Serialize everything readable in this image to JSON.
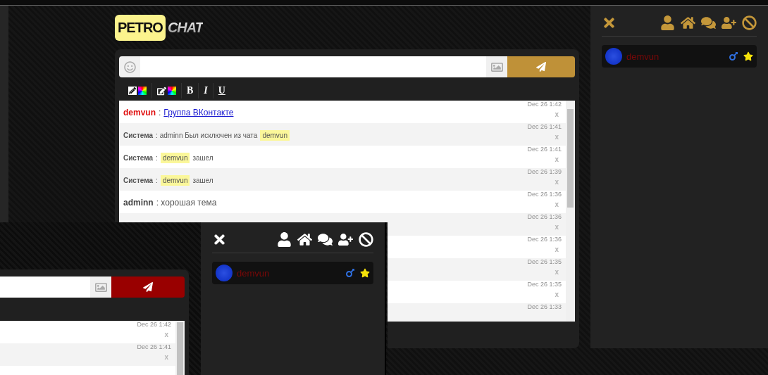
{
  "logo": {
    "part_1": "PETRO",
    "part_2": "CHAT"
  },
  "toolbar": [
    {
      "kind": "pen-color"
    },
    {
      "kind": "edit-color"
    },
    {
      "kind": "bold",
      "label": "B"
    },
    {
      "kind": "italic",
      "label": "I"
    },
    {
      "kind": "underline",
      "label": "U"
    }
  ],
  "messages": [
    {
      "kind": "user",
      "author": "demvun",
      "parts": [
        {
          "kind": "text",
          "text": ":"
        },
        {
          "kind": "link",
          "text": "Группа ВКонтакте"
        }
      ],
      "time": "Dec 26 1:42",
      "delete": "x"
    },
    {
      "kind": "system",
      "author": "Система",
      "parts": [
        {
          "kind": "text",
          "text": ": adminn Был исключен из чата"
        },
        {
          "kind": "mention",
          "text": "demvun"
        }
      ],
      "time": "Dec 26 1:41",
      "delete": "x"
    },
    {
      "kind": "system",
      "author": "Система",
      "parts": [
        {
          "kind": "text",
          "text": ":"
        },
        {
          "kind": "mention",
          "text": "demvun"
        },
        {
          "kind": "text",
          "text": "зашел"
        }
      ],
      "time": "Dec 26 1:41",
      "delete": "x"
    },
    {
      "kind": "system",
      "author": "Система",
      "parts": [
        {
          "kind": "text",
          "text": ":"
        },
        {
          "kind": "mention",
          "text": "demvun"
        },
        {
          "kind": "text",
          "text": "зашел"
        }
      ],
      "time": "Dec 26 1:39",
      "delete": "x"
    },
    {
      "kind": "admin",
      "author": "adminn",
      "parts": [
        {
          "kind": "text",
          "text": ": хорошая тема"
        }
      ],
      "time": "Dec 26 1:36",
      "delete": "x"
    },
    {
      "kind": "hidden",
      "time": "Dec 26 1:36",
      "delete": "x"
    },
    {
      "kind": "hidden",
      "time": "Dec 26 1:36",
      "delete": "x"
    },
    {
      "kind": "hidden",
      "time": "Dec 26 1:35",
      "delete": "x"
    },
    {
      "kind": "hidden",
      "time": "Dec 26 1:35",
      "delete": "x"
    },
    {
      "kind": "hidden",
      "time": "Dec 26 1:33"
    }
  ],
  "users": [
    {
      "name": "demvun"
    }
  ],
  "overlay": {
    "messages": [
      {
        "time": "Dec 26 1:42",
        "delete": "x"
      },
      {
        "time": "Dec 26 1:41",
        "delete": "x"
      }
    ],
    "users": [
      {
        "name": "demvun"
      }
    ]
  }
}
